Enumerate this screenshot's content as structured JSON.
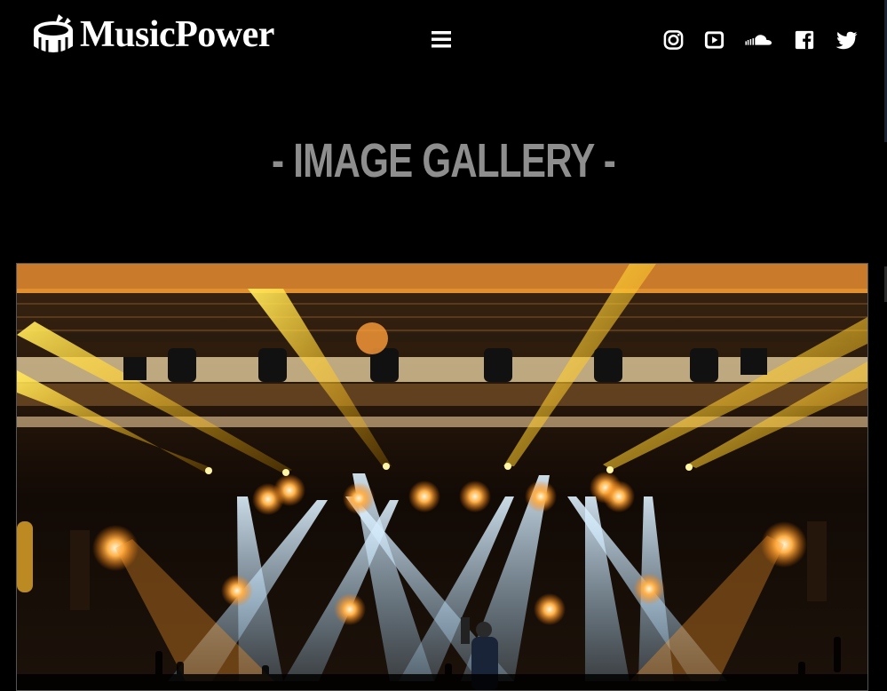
{
  "header": {
    "brand": "MusicPower",
    "menu_icon": "hamburger-icon",
    "social": [
      {
        "name": "instagram",
        "icon": "instagram-icon"
      },
      {
        "name": "youtube",
        "icon": "youtube-icon"
      },
      {
        "name": "soundcloud",
        "icon": "soundcloud-icon"
      },
      {
        "name": "facebook",
        "icon": "facebook-icon"
      },
      {
        "name": "twitter",
        "icon": "twitter-icon"
      }
    ]
  },
  "main": {
    "title": "- IMAGE GALLERY -"
  },
  "colors": {
    "background": "#000000",
    "title": "#8e8e8e",
    "header_text": "#ffffff",
    "stage_orange": "#ff9a2a",
    "stage_blue": "#a9d3f0"
  }
}
